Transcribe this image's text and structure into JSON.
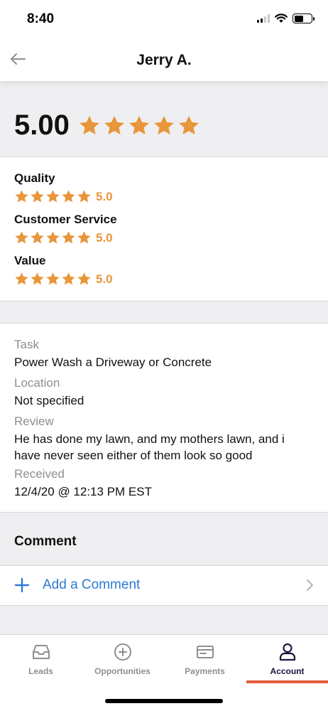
{
  "status_bar": {
    "time": "8:40"
  },
  "header": {
    "title": "Jerry A."
  },
  "overall": {
    "score": "5.00",
    "stars": 5
  },
  "ratings": [
    {
      "label": "Quality",
      "score": "5.0",
      "stars": 5
    },
    {
      "label": "Customer Service",
      "score": "5.0",
      "stars": 5
    },
    {
      "label": "Value",
      "score": "5.0",
      "stars": 5
    }
  ],
  "details": {
    "task_label": "Task",
    "task_value": "Power Wash a Driveway or Concrete",
    "location_label": "Location",
    "location_value": "Not specified",
    "review_label": "Review",
    "review_value": "He has done my lawn, and my mothers lawn, and i have never seen either of them look so good",
    "received_label": "Received",
    "received_value": "12/4/20 @ 12:13 PM EST"
  },
  "comment": {
    "title": "Comment",
    "add_label": "Add a Comment"
  },
  "tabs": [
    {
      "label": "Leads",
      "icon": "inbox-icon"
    },
    {
      "label": "Opportunities",
      "icon": "plus-circle-icon"
    },
    {
      "label": "Payments",
      "icon": "card-icon"
    },
    {
      "label": "Account",
      "icon": "person-icon",
      "active": true
    }
  ],
  "colors": {
    "star": "#e8963a",
    "link": "#2c7ad6",
    "active_tab": "#15183d",
    "tab_indicator": "#e35b3c"
  }
}
